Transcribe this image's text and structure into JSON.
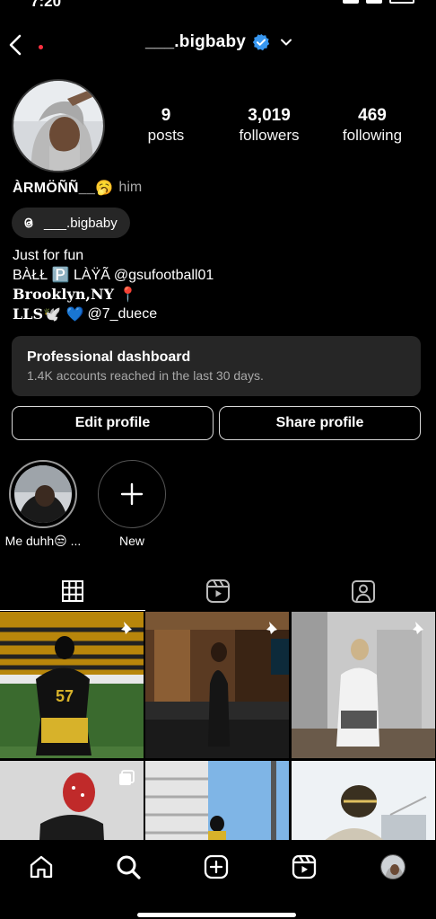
{
  "status_bar": {
    "time": "7:20"
  },
  "header": {
    "username": "___.bigbaby"
  },
  "profile": {
    "stats": [
      {
        "value": "9",
        "label": "posts"
      },
      {
        "value": "3,019",
        "label": "followers"
      },
      {
        "value": "469",
        "label": "following"
      }
    ],
    "display_name": "ÀRMÖÑÑ__🥱",
    "pronouns": "him",
    "threads_handle": "___.bigbaby",
    "bio": {
      "line1": "Just for fun",
      "line2_prefix": "BÀŁŁ 🅿️ LÀŸÃ",
      "line2_mention": "@gsufootball01",
      "line3": "𝐁𝐫𝐨𝐨𝐤𝐥𝐲𝐧,𝐍𝐘 📍",
      "line4_prefix": "𝐋𝐋𝐒🕊️ 💙",
      "line4_mention": "@7_duece"
    }
  },
  "dashboard": {
    "title": "Professional dashboard",
    "subtitle": "1.4K accounts reached in the last 30 days."
  },
  "buttons": {
    "edit": "Edit profile",
    "share": "Share profile"
  },
  "highlights": [
    {
      "label": "Me duhh😒 ..."
    },
    {
      "label": "New"
    }
  ],
  "colors": {
    "background": "#000000",
    "surface": "#262626",
    "verified_blue": "#3897f0",
    "secondary_text": "#a8a8a8",
    "notification_red": "#ff3040"
  }
}
